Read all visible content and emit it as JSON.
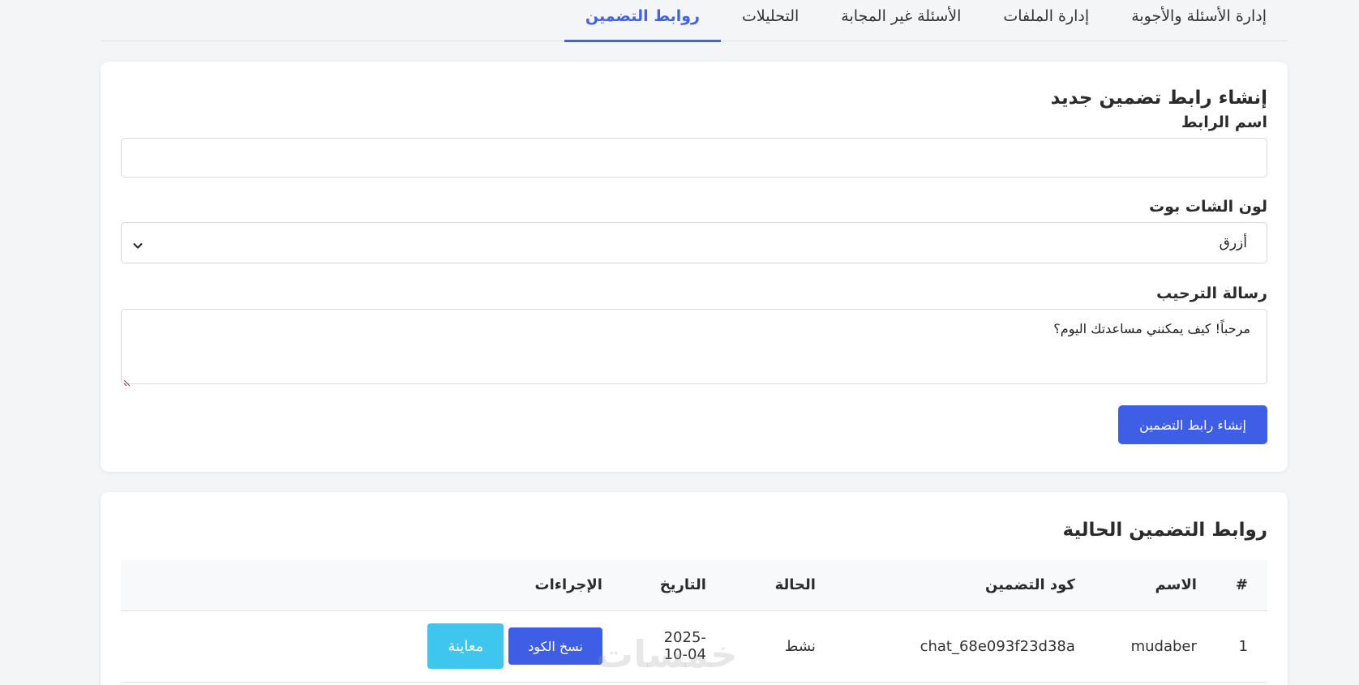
{
  "tabs": [
    {
      "label": "إدارة الأسئلة والأجوبة",
      "active": false
    },
    {
      "label": "إدارة الملفات",
      "active": false
    },
    {
      "label": "الأسئلة غير المجابة",
      "active": false
    },
    {
      "label": "التحليلات",
      "active": false
    },
    {
      "label": "روابط التضمين",
      "active": true
    }
  ],
  "create_form": {
    "title": "إنشاء رابط تضمين جديد",
    "name_label": "اسم الرابط",
    "name_value": "",
    "color_label": "لون الشات بوت",
    "color_selected": "أزرق",
    "welcome_label": "رسالة الترحيب",
    "welcome_value": "مرحباً! كيف يمكنني مساعدتك اليوم؟",
    "submit_label": "إنشاء رابط التضمين"
  },
  "links_table": {
    "title": "روابط التضمين الحالية",
    "headers": [
      "#",
      "الاسم",
      "كود التضمين",
      "الحالة",
      "التاريخ",
      "الإجراءات"
    ],
    "rows": [
      {
        "index": "1",
        "name": "mudaber",
        "code": "chat_68e093f23d38a",
        "status": "نشط",
        "date": "2025-10-04",
        "copy_label": "نسخ الكود",
        "preview_label": "معاينة"
      }
    ]
  },
  "watermark": "خمسات",
  "colors": {
    "accent": "#3f5ee6",
    "preview": "#3ec6ef",
    "status_active": "#1a8f2d"
  }
}
